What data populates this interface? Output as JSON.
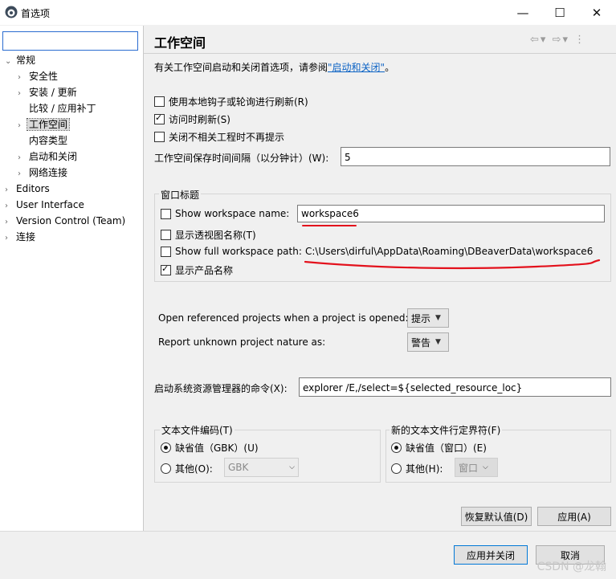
{
  "window": {
    "title": "首选项",
    "controls": {
      "minimize": "—",
      "maximize": "☐",
      "close": "✕"
    }
  },
  "sidebar": {
    "filter_placeholder": "",
    "items": [
      {
        "label": "常规",
        "arrow": "⌄"
      },
      {
        "label": "安全性",
        "arrow": "›"
      },
      {
        "label": "安装 / 更新",
        "arrow": "›"
      },
      {
        "label": "比较 / 应用补丁",
        "arrow": ""
      },
      {
        "label": "工作空间",
        "arrow": "›"
      },
      {
        "label": "内容类型",
        "arrow": ""
      },
      {
        "label": "启动和关闭",
        "arrow": "›"
      },
      {
        "label": "网络连接",
        "arrow": "›"
      },
      {
        "label": "Editors",
        "arrow": "›"
      },
      {
        "label": "User Interface",
        "arrow": "›"
      },
      {
        "label": "Version Control (Team)",
        "arrow": "›"
      },
      {
        "label": "连接",
        "arrow": "›"
      }
    ]
  },
  "page": {
    "title": "工作空间",
    "nav": {
      "back": "⇦",
      "back_dd": "▾",
      "forward": "⇨",
      "forward_dd": "▾",
      "menu": "⋮"
    },
    "description_prefix": "有关工作空间启动和关闭首选项，请参阅",
    "description_link": "\"启动和关闭\"",
    "description_suffix": "。"
  },
  "options": {
    "refresh_native": "使用本地钩子或轮询进行刷新(R)",
    "refresh_on_access": "访问时刷新(S)",
    "close_unrelated_prompt": "关闭不相关工程时不再提示",
    "save_interval_label": "工作空间保存时间间隔（以分钟计）(W):",
    "save_interval_value": "5"
  },
  "window_title_group": {
    "title": "窗口标题",
    "show_name_label": "Show workspace name:",
    "show_name_value": "workspace6",
    "show_perspective": "显示透视图名称(T)",
    "show_full_path_label": "Show full workspace path:",
    "show_full_path_value": "C:\\Users\\dirful\\AppData\\Roaming\\DBeaverData\\workspace6",
    "show_product": "显示产品名称"
  },
  "projects": {
    "open_referenced_label": "Open referenced projects when a project is opened:",
    "open_referenced_value": "提示",
    "unknown_nature_label": "Report unknown project nature as:",
    "unknown_nature_value": "警告"
  },
  "explorer": {
    "label": "启动系统资源管理器的命令(X):",
    "value": "explorer /E,/select=${selected_resource_loc}"
  },
  "encoding": {
    "title": "文本文件编码(T)",
    "default_label": "缺省值（GBK）(U)",
    "other_label": "其他(O):",
    "other_value": "GBK"
  },
  "line_delimiter": {
    "title": "新的文本文件行定界符(F)",
    "default_label": "缺省值（窗口）(E)",
    "other_label": "其他(H):",
    "other_value": "窗口"
  },
  "buttons": {
    "restore_defaults": "恢复默认值(D)",
    "apply": "应用(A)",
    "apply_and_close": "应用并关闭",
    "cancel": "取消"
  },
  "watermark": "CSDN @龙翰",
  "colors": {
    "accent": "#0078d7",
    "annotation_red": "#e3111c",
    "link": "#0b62c4"
  }
}
